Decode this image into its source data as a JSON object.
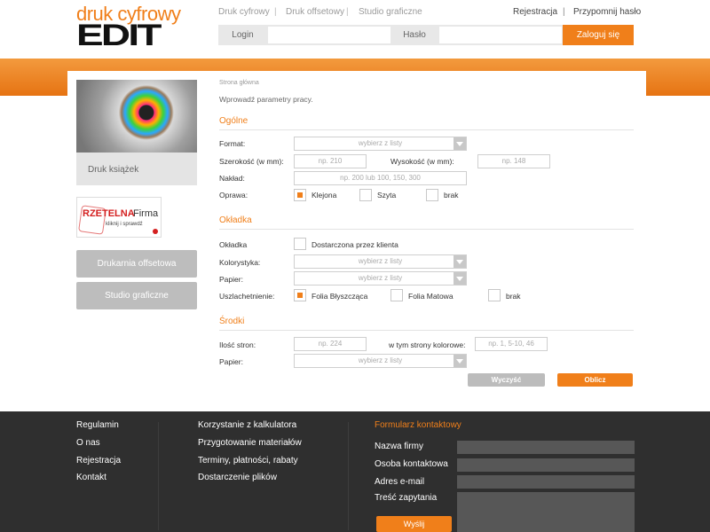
{
  "brand": {
    "tagline": "druk cyfrowy",
    "name": "EDIT"
  },
  "topnav": {
    "items": [
      "Druk cyfrowy",
      "Druk offsetowy",
      "Studio graficzne"
    ],
    "separator": "|"
  },
  "account": {
    "register": "Rejestracja",
    "separator": "|",
    "remind": "Przypomnij hasło"
  },
  "login": {
    "login_label": "Login",
    "password_label": "Hasło",
    "submit": "Zaloguj się"
  },
  "sidebar": {
    "book_label": "Druk książek",
    "badge": {
      "title_red": "RZETELNA",
      "title_dark": "Firma",
      "sub": "kliknij i sprawdź"
    },
    "buttons": [
      "Drukarnia offsetowa",
      "Studio graficzne"
    ]
  },
  "form": {
    "breadcrumb": "Strona główna",
    "intro": "Wprowadź parametry pracy.",
    "sections": {
      "general": "Ogólne",
      "cover": "Okładka",
      "inside": "Środki"
    },
    "general": {
      "format_label": "Format:",
      "format_placeholder": "wybierz z listy",
      "width_label": "Szerokość (w mm):",
      "width_placeholder": "np. 210",
      "height_label": "Wysokość (w mm):",
      "height_placeholder": "np. 148",
      "run_label": "Nakład:",
      "run_placeholder": "np. 200 lub 100, 150, 300",
      "binding_label": "Oprawa:",
      "binding_options": [
        {
          "label": "Klejona",
          "checked": true
        },
        {
          "label": "Szyta",
          "checked": false
        },
        {
          "label": "brak",
          "checked": false
        }
      ]
    },
    "cover": {
      "cover_label": "Okładka",
      "supplied_label": "Dostarczona przez klienta",
      "supplied_checked": false,
      "color_label": "Kolorystyka:",
      "color_placeholder": "wybierz z listy",
      "paper_label": "Papier:",
      "paper_placeholder": "wybierz z listy",
      "finish_label": "Uszlachetnienie:",
      "finish_options": [
        {
          "label": "Folia Błyszcząca",
          "checked": true
        },
        {
          "label": "Folia Matowa",
          "checked": false
        },
        {
          "label": "brak",
          "checked": false
        }
      ]
    },
    "inside": {
      "pages_label": "Ilość stron:",
      "pages_placeholder": "np. 224",
      "color_pages_label": "w tym strony kolorowe:",
      "color_pages_placeholder": "np. 1, 5-10, 46",
      "paper_label": "Papier:",
      "paper_placeholder": "wybierz z listy"
    },
    "reset": "Wyczyść",
    "calculate": "Oblicz"
  },
  "footer": {
    "col1": [
      "Regulamin",
      "O nas",
      "Rejestracja",
      "Kontakt"
    ],
    "col2": [
      "Korzystanie z kalkulatora",
      "Przygotowanie materiałów",
      "Terminy, płatności, rabaty",
      "Dostarczenie plików"
    ],
    "contact_form": {
      "title": "Formularz kontaktowy",
      "fields": [
        "Nazwa firmy",
        "Osoba kontaktowa",
        "Adres e-mail",
        "Treść zapytania"
      ],
      "send": "Wyślij"
    }
  },
  "colors": {
    "accent": "#f07f1a",
    "footer_bg": "#2f2f2f",
    "button_grey": "#bdbdbd"
  },
  "icons": {
    "dropdown": "chevron-down-icon",
    "checkbox": "checkbox-icon"
  }
}
